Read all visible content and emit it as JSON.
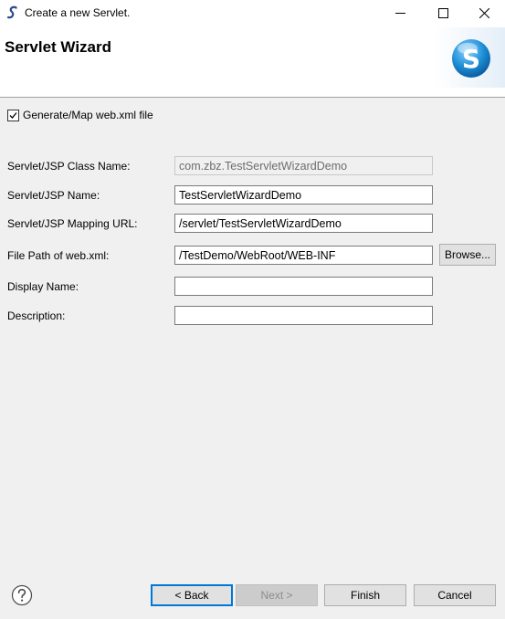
{
  "window": {
    "title": "Create a new Servlet."
  },
  "banner": {
    "heading": "Servlet Wizard",
    "logo_letter": "S"
  },
  "options": {
    "generate_map_label": "Generate/Map web.xml file",
    "generate_map_checked": true
  },
  "form": {
    "class_name_label": "Servlet/JSP Class Name:",
    "class_name_value": "com.zbz.TestServletWizardDemo",
    "name_label": "Servlet/JSP Name:",
    "name_value": "TestServletWizardDemo",
    "mapping_label": "Servlet/JSP Mapping URL:",
    "mapping_value": "/servlet/TestServletWizardDemo",
    "filepath_label": "File Path of web.xml:",
    "filepath_value": "/TestDemo/WebRoot/WEB-INF",
    "browse_label": "Browse...",
    "display_name_label": "Display Name:",
    "display_name_value": "",
    "description_label": "Description:",
    "description_value": ""
  },
  "buttons": {
    "back": "< Back",
    "next": "Next >",
    "finish": "Finish",
    "cancel": "Cancel"
  },
  "colors": {
    "accent": "#0078d7",
    "logo_blue": "#1e8fd6"
  }
}
